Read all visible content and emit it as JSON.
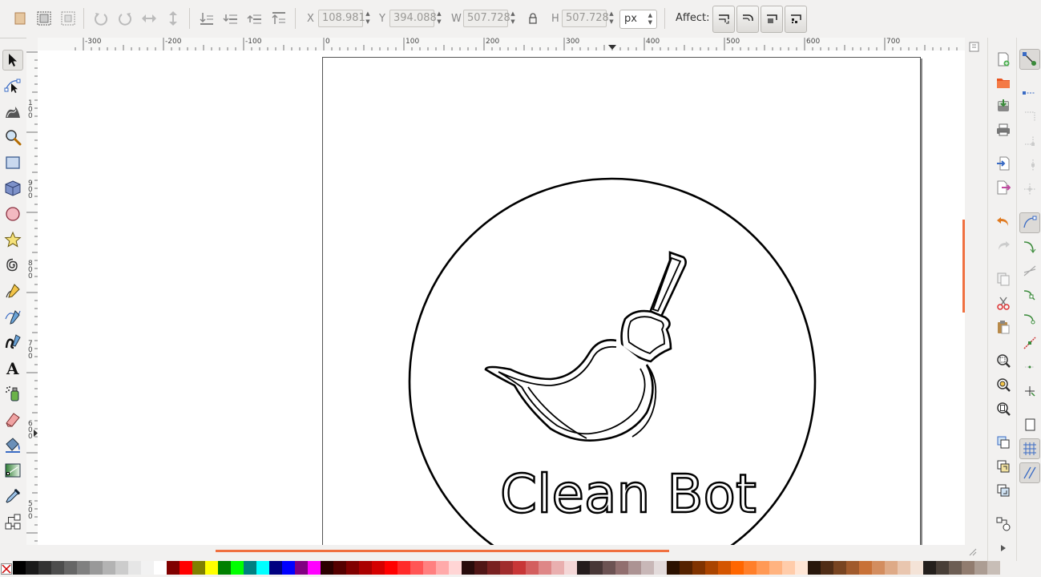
{
  "toolbar": {
    "x_label": "X",
    "x_value": "108.981",
    "y_label": "Y",
    "y_value": "394.088",
    "w_label": "W",
    "w_value": "507.728",
    "h_label": "H",
    "h_value": "507.728",
    "unit": "px",
    "affect_label": "Affect:"
  },
  "ruler_h_labels": [
    "-300",
    "-200",
    "-100",
    "0",
    "100",
    "200",
    "300",
    "400",
    "500",
    "600",
    "700"
  ],
  "ruler_v_labels": [
    "1\n0\n0",
    "9\n0\n0",
    "8\n0\n0",
    "7\n0\n0",
    "6\n0\n0",
    "5\n0\n0"
  ],
  "drawing": {
    "logo_text": "Clean Bot"
  },
  "tools": [
    "selector-icon",
    "node-editor-icon",
    "tweak-icon",
    "zoom-icon",
    "rectangle-icon",
    "3d-box-icon",
    "ellipse-icon",
    "star-icon",
    "spiral-icon",
    "pencil-icon",
    "pen-icon",
    "calligraphy-icon",
    "text-icon",
    "spray-icon",
    "eraser-icon",
    "paint-bucket-icon",
    "gradient-icon",
    "dropper-icon",
    "connector-icon"
  ],
  "palette_colors": [
    "#000000",
    "#1a1a1a",
    "#333333",
    "#4d4d4d",
    "#666666",
    "#808080",
    "#999999",
    "#b3b3b3",
    "#cccccc",
    "#e6e6e6",
    "#f2f2f2",
    "#ffffff",
    "#800000",
    "#ff0000",
    "#808000",
    "#ffff00",
    "#008000",
    "#00ff00",
    "#008080",
    "#00ffff",
    "#000080",
    "#0000ff",
    "#800080",
    "#ff00ff",
    "#2b0000",
    "#550000",
    "#800000",
    "#aa0000",
    "#d40000",
    "#ff0000",
    "#ff2a2a",
    "#ff5555",
    "#ff8080",
    "#ffaaaa",
    "#ffd5d5",
    "#280b0b",
    "#501616",
    "#782121",
    "#a02c2c",
    "#c83737",
    "#d35f5f",
    "#de8787",
    "#e9afaf",
    "#f4d7d7",
    "#241c1c",
    "#483737",
    "#6c5353",
    "#916f6f",
    "#ac9393",
    "#c8b7b7",
    "#e3dbdb",
    "#2b1100",
    "#552200",
    "#803300",
    "#aa4400",
    "#d45500",
    "#ff6600",
    "#ff7f2a",
    "#ff9955",
    "#ffb380",
    "#ffccaa",
    "#ffe6d5",
    "#28170b",
    "#502d16",
    "#784421",
    "#a05a2c",
    "#c87137",
    "#d38d5f",
    "#deaa87",
    "#e9c6af",
    "#f4e3d7",
    "#241f1c",
    "#483e37",
    "#6c5d53",
    "#917c6f",
    "#ac9d93",
    "#c8beb7"
  ]
}
